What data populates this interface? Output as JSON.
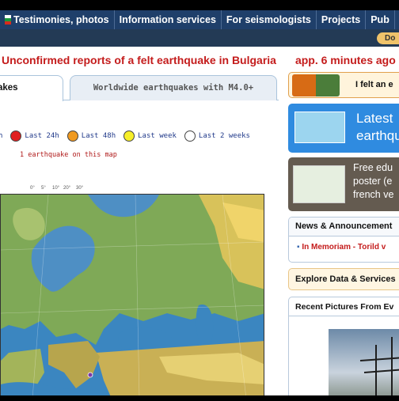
{
  "nav": {
    "items": [
      "Testimonies, photos",
      "Information services",
      "For seismologists",
      "Projects",
      "Pub"
    ],
    "pill": "Do"
  },
  "banner": {
    "title": "Unconfirmed reports of a felt earthquake in Bulgaria",
    "time": "app. 6 minutes ago"
  },
  "tabs": {
    "active": "akes",
    "other": "Worldwide earthquakes with M4.0+"
  },
  "legend": {
    "items": [
      {
        "label": "h",
        "color": "#ffffff"
      },
      {
        "label": "Last 24h",
        "color": "#e02020"
      },
      {
        "label": "Last 48h",
        "color": "#f09a20"
      },
      {
        "label": "Last week",
        "color": "#f7ef2a"
      },
      {
        "label": "Last 2 weeks",
        "color": "#ffffff"
      }
    ],
    "count": "1 earthquake on this map"
  },
  "map": {
    "scale_labels": [
      "0°",
      "5°",
      "10°",
      "20°",
      "30°"
    ]
  },
  "right": {
    "felt_label": "I felt an e",
    "latest": [
      "Latest",
      "earthqu"
    ],
    "poster": [
      "Free edu",
      "poster (e",
      "french ve"
    ],
    "news_title": "News & Announcement",
    "news_item": "In Memoriam - Torild v",
    "explore_title": "Explore Data & Services",
    "pics_title": "Recent Pictures From Ev"
  },
  "colors": {
    "nav": "#1f3f6a",
    "banner": "#c41c1c",
    "latest": "#2f8be0",
    "poster": "#645b50"
  }
}
